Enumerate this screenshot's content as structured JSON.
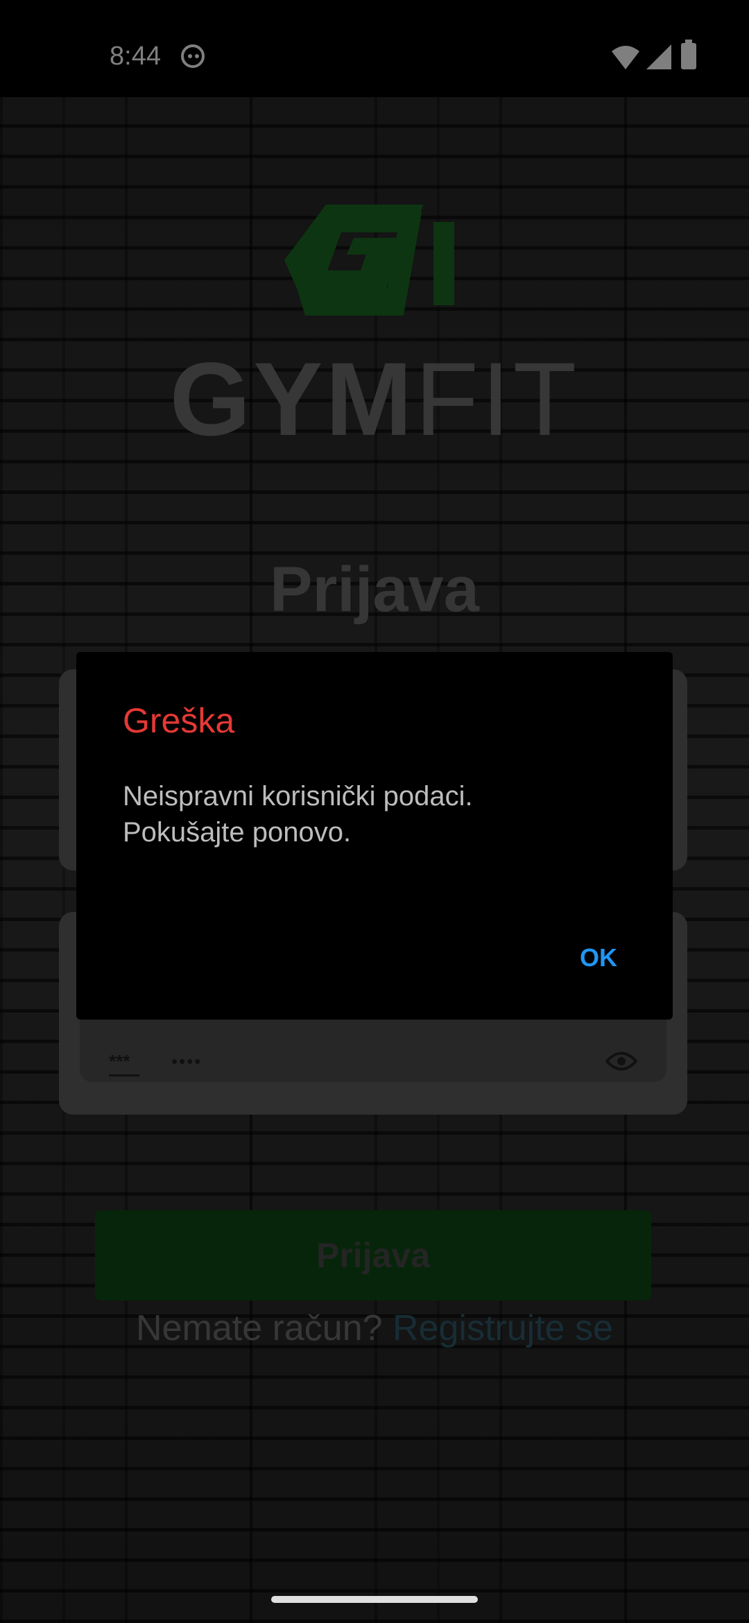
{
  "status_bar": {
    "time": "8:44",
    "icons": [
      "cat-icon",
      "wifi-icon",
      "signal-icon",
      "battery-icon"
    ]
  },
  "logo": {
    "brand_bold": "GYM",
    "brand_light": "FIT",
    "mark_color": "#1b6b22"
  },
  "page": {
    "title": "Prijava"
  },
  "password_field": {
    "icon_text": "***",
    "value_masked": "••••"
  },
  "actions": {
    "login_label": "Prijava",
    "no_account_text": "Nemate račun?",
    "register_link": "Registrujte se"
  },
  "dialog": {
    "title": "Greška",
    "message_line1": "Neispravni korisnički podaci.",
    "message_line2": "Pokušajte ponovo.",
    "ok_label": "OK",
    "title_color": "#e53935",
    "ok_color": "#2196f3"
  }
}
